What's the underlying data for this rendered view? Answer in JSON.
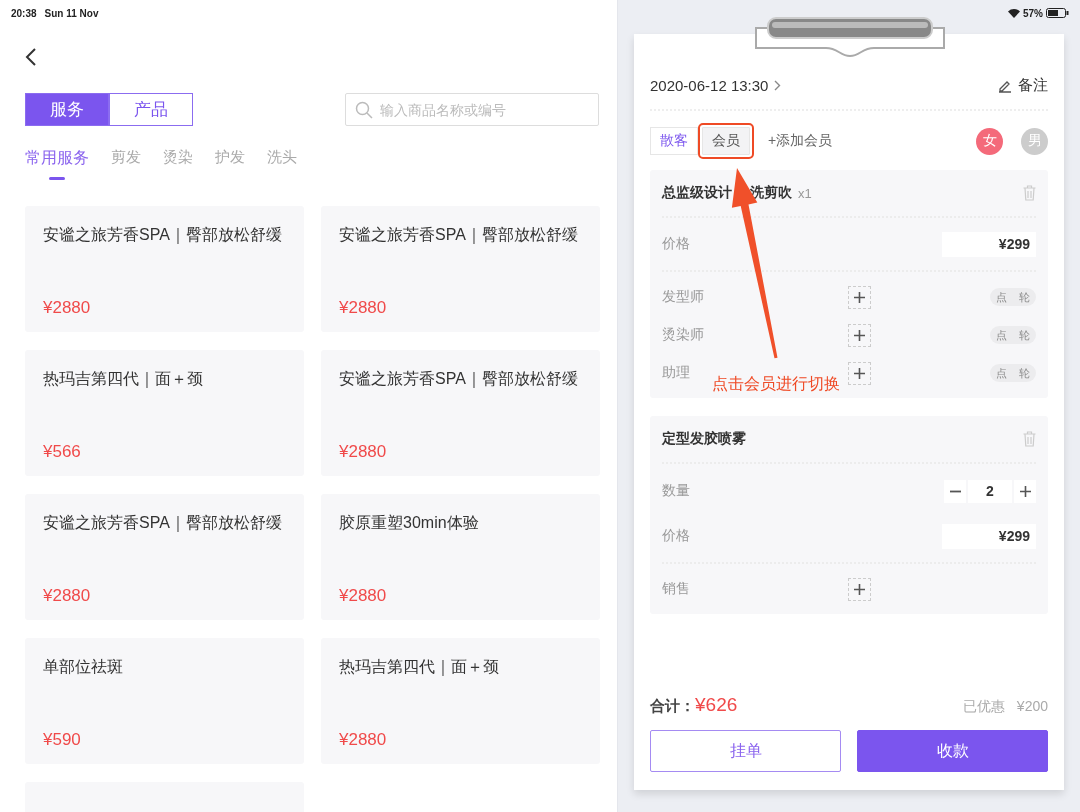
{
  "status_bar": {
    "time": "20:38",
    "date": "Sun 11 Nov",
    "battery": "57%"
  },
  "left": {
    "segments": [
      {
        "label": "服务",
        "selected": true
      },
      {
        "label": "产品",
        "selected": false
      }
    ],
    "search": {
      "placeholder": "输入商品名称或编号"
    },
    "categories": [
      {
        "label": "常用服务",
        "selected": true
      },
      {
        "label": "剪发",
        "selected": false
      },
      {
        "label": "烫染",
        "selected": false
      },
      {
        "label": "护发",
        "selected": false
      },
      {
        "label": "洗头",
        "selected": false
      }
    ],
    "items": [
      {
        "kind": "service",
        "name": "安谧之旅芳香SPA｜臀部放松舒缓",
        "price": "¥2880"
      },
      {
        "kind": "service",
        "name": "安谧之旅芳香SPA｜臀部放松舒缓",
        "price": "¥2880"
      },
      {
        "kind": "service",
        "name": "热玛吉第四代｜面＋颈",
        "price": "¥566"
      },
      {
        "kind": "service",
        "name": "安谧之旅芳香SPA｜臀部放松舒缓",
        "price": "¥2880"
      },
      {
        "kind": "service",
        "name": "安谧之旅芳香SPA｜臀部放松舒缓",
        "price": "¥2880"
      },
      {
        "kind": "service",
        "name": "胶原重塑30min体验",
        "price": "¥2880"
      },
      {
        "kind": "service",
        "name": "单部位祛斑",
        "price": "¥590"
      },
      {
        "kind": "service",
        "name": "热玛吉第四代｜面＋颈",
        "price": "¥2880"
      },
      {
        "kind": "partial"
      }
    ]
  },
  "order": {
    "datetime": "2020-06-12 13:30",
    "note": "备注",
    "customer_types": [
      {
        "label": "散客",
        "selected": true,
        "highlighted": false
      },
      {
        "label": "会员",
        "selected": false,
        "highlighted": true
      }
    ],
    "add_member": "+添加会员",
    "genders": [
      {
        "label": "女",
        "selected": true
      },
      {
        "label": "男",
        "selected": false
      }
    ],
    "lines": [
      {
        "kind": "service",
        "name_parts": [
          "总监级设计",
          "洗剪吹"
        ],
        "qty": "x1",
        "price_label": "价格",
        "price": "¥299",
        "staff": [
          {
            "role": "发型师",
            "options": [
              "点",
              "轮"
            ]
          },
          {
            "role": "烫染师",
            "options": [
              "点",
              "轮"
            ]
          },
          {
            "role": "助理",
            "options": [
              "点",
              "轮"
            ]
          }
        ]
      },
      {
        "kind": "product",
        "name_parts": [
          "定型发胶喷雾"
        ],
        "quantity_label": "数量",
        "quantity": "2",
        "price_label": "价格",
        "price": "¥299",
        "staff": [
          {
            "role": "销售"
          }
        ]
      }
    ],
    "total_label": "合计：",
    "total": "¥626",
    "discount_label": "已优惠",
    "discount": "¥200",
    "buttons": [
      {
        "label": "挂单",
        "kind": "secondary"
      },
      {
        "label": "收款",
        "kind": "primary"
      }
    ]
  },
  "annotation": {
    "text": "点击会员进行切换"
  }
}
